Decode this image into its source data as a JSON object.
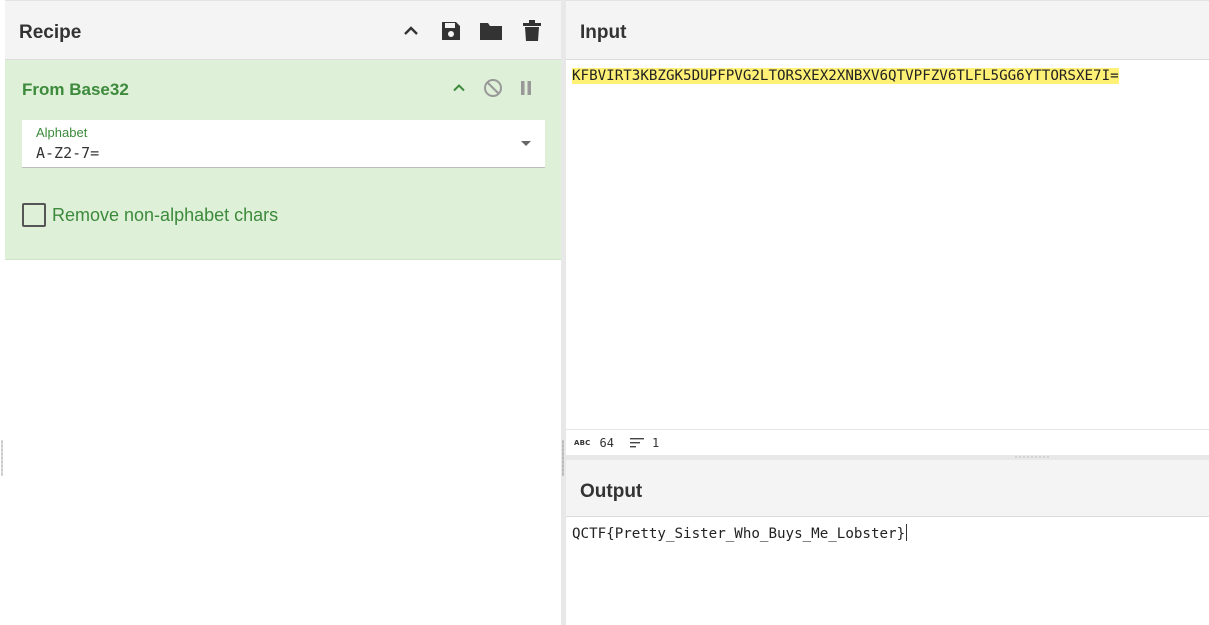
{
  "recipe": {
    "title": "Recipe",
    "operation": {
      "name": "From Base32",
      "alphabet_label": "Alphabet",
      "alphabet_value": "A-Z2-7=",
      "remove_non_alphabet_label": "Remove non-alphabet chars",
      "remove_non_alphabet_checked": false
    }
  },
  "input": {
    "title": "Input",
    "text": "KFBVIRT3KBZGK5DUPFPVG2LTORSXEX2XNBXV6QTVPFZV6TLFL5GG6YTTORSXE7I=",
    "status": {
      "abc_label": "ABC",
      "char_count": "64",
      "line_count": "1"
    }
  },
  "output": {
    "title": "Output",
    "text": "QCTF{Pretty_Sister_Who_Buys_Me_Lobster}"
  },
  "colors": {
    "operation_bg": "#dff0d8",
    "operation_text": "#3c8a3c",
    "highlight": "#fff176"
  }
}
